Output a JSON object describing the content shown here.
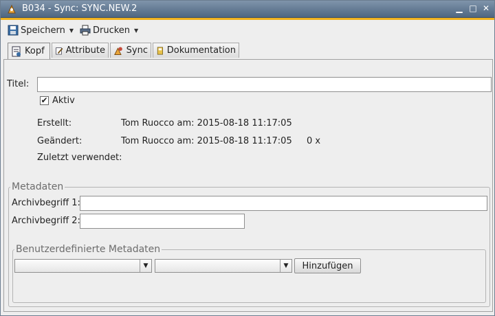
{
  "window": {
    "title": "B034 - Sync: SYNC.NEW.2",
    "minimize": "▁",
    "maximize": "□",
    "close": "✕"
  },
  "toolbar": {
    "save_label": "Speichern",
    "print_label": "Drucken",
    "dropdown_glyph": "▼"
  },
  "tabs": [
    {
      "label": "Kopf",
      "icon": "header-doc-icon",
      "active": true
    },
    {
      "label": "Attribute",
      "icon": "edit-attributes-icon",
      "active": false
    },
    {
      "label": "Sync",
      "icon": "sync-icon",
      "active": false
    },
    {
      "label": "Dokumentation",
      "icon": "book-icon",
      "active": false
    }
  ],
  "form": {
    "title_label": "Titel:",
    "title_value": "",
    "active_label": "Aktiv",
    "active_checked": true,
    "active_check_glyph": "✔",
    "created_label": "Erstellt:",
    "created_value": "Tom Ruocco am: 2015-08-18 11:17:05",
    "changed_label": "Geändert:",
    "changed_value": "Tom Ruocco am: 2015-08-18 11:17:05",
    "changed_count": "0 x",
    "last_used_label": "Zuletzt verwendet:"
  },
  "metadata": {
    "legend": "Metadaten",
    "archive1_label": "Archivbegriff 1:",
    "archive1_value": "",
    "archive2_label": "Archivbegriff 2:",
    "archive2_value": ""
  },
  "custom_metadata": {
    "legend": "Benutzerdefinierte Metadaten",
    "combo1_value": "",
    "combo2_value": "",
    "dropdown_glyph": "▼",
    "add_label": "Hinzufügen"
  },
  "colors": {
    "titlebar": "#5b7089",
    "accent": "#f0b21e",
    "background": "#eeeeee"
  }
}
